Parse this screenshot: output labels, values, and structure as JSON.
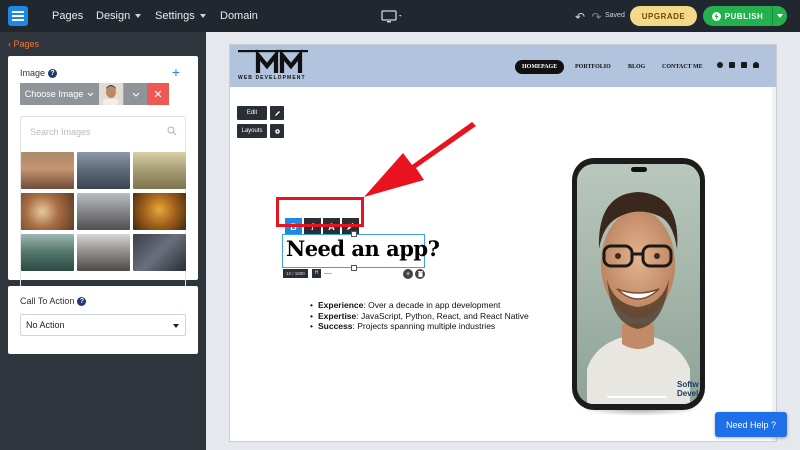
{
  "topbar": {
    "nav": [
      "Pages",
      "Design",
      "Settings",
      "Domain"
    ],
    "saved": "Saved",
    "upgrade": "UPGRADE",
    "publish": "PUBLISH",
    "icons": [
      "menu-icon",
      "desktop-icon",
      "undo-icon",
      "redo-icon",
      "bolt-icon"
    ]
  },
  "sidebar": {
    "back": "Pages",
    "image_panel": {
      "label": "Image",
      "choose_label": "Choose Image",
      "search_placeholder": "Search Images"
    },
    "cta_panel": {
      "label": "Call To Action",
      "selected": "No Action"
    }
  },
  "site": {
    "brand_sub": "WEB DEVELOPMENT",
    "nav": [
      "HOMEPAGE",
      "PORTFOLIO",
      "BLOG",
      "CONTACT ME"
    ],
    "edit_label": "Edit",
    "layouts_label": "Layouts",
    "headline": "Need an app?",
    "char_counter": "12 / 1500",
    "heading_tag": "H",
    "bullets": [
      {
        "term": "Experience",
        "text": ": Over a decade in app development"
      },
      {
        "term": "Expertise",
        "text": ": JavaScript, Python, React, and React Native"
      },
      {
        "term": "Success",
        "text": ": Projects spanning multiple industries"
      }
    ],
    "phone_text_1": "Softw",
    "phone_text_2": "Devel"
  },
  "format_toolbar": [
    "B",
    "I",
    "A"
  ],
  "need_help": "Need Help ?",
  "colors": {
    "accent": "#1e88e5",
    "publish": "#22b14c",
    "upgrade": "#f5d98a",
    "annotation": "#e8131e",
    "site_header": "#b2c3de"
  }
}
